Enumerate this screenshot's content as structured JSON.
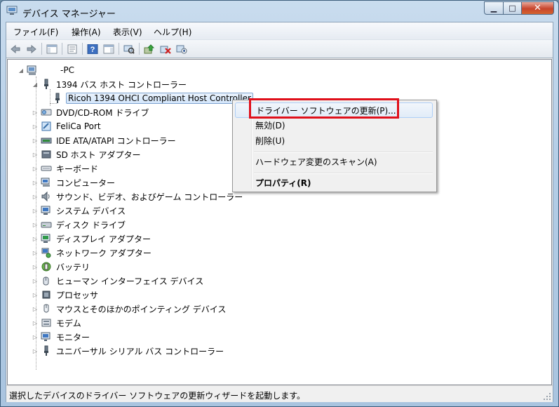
{
  "window": {
    "title": "デバイス マネージャー",
    "min_label": "▁",
    "max_label": "□",
    "close_label": "✕"
  },
  "menu": [
    "ファイル(F)",
    "操作(A)",
    "表示(V)",
    "ヘルプ(H)"
  ],
  "toolbar": {
    "buttons": [
      "back-icon",
      "forward-icon",
      "show-hide-console-tree-icon",
      "properties-icon",
      "help-icon",
      "show-action-pane-icon",
      "scan-hardware-icon",
      "update-driver-icon",
      "uninstall-icon",
      "disable-icon"
    ]
  },
  "tree": {
    "root": "-PC",
    "usb1394_label": "1394 バス ホスト コントローラー",
    "selected_device": "Ricoh 1394 OHCI Compliant Host Controller",
    "categories": [
      "DVD/CD-ROM ドライブ",
      "FeliCa Port",
      "IDE ATA/ATAPI コントローラー",
      "SD ホスト アダプター",
      "キーボード",
      "コンピューター",
      "サウンド、ビデオ、およびゲーム コントローラー",
      "システム デバイス",
      "ディスク ドライブ",
      "ディスプレイ アダプター",
      "ネットワーク アダプター",
      "バッテリ",
      "ヒューマン インターフェイス デバイス",
      "プロセッサ",
      "マウスとそのほかのポインティング デバイス",
      "モデム",
      "モニター",
      "ユニバーサル シリアル バス コントローラー"
    ]
  },
  "context_menu": {
    "update_driver": "ドライバー ソフトウェアの更新(P)...",
    "disable": "無効(D)",
    "uninstall": "削除(U)",
    "scan": "ハードウェア変更のスキャン(A)",
    "properties": "プロパティ(R)"
  },
  "status": "選択したデバイスのドライバー ソフトウェアの更新ウィザードを起動します。",
  "colors": {
    "highlight_box": "#e0101b",
    "title_gradient": "#b4cde6"
  }
}
